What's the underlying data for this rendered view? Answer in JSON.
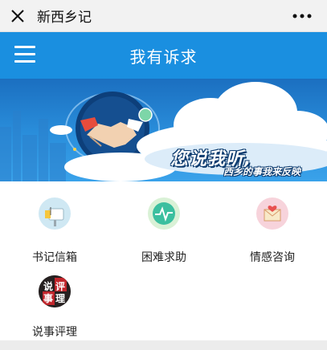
{
  "window": {
    "title": "新西乡记",
    "close_icon": "close-icon",
    "more_icon": "more-dots-icon"
  },
  "header": {
    "title": "我有诉求",
    "menu_icon": "hamburger-menu-icon",
    "color": "#1a8fe0"
  },
  "banner": {
    "slogan": "您说我听,",
    "subslogan": "西乡的事我来反映",
    "image": "handshake-cloud-illustration"
  },
  "services": [
    {
      "label": "书记信箱",
      "icon": "mailbox-icon"
    },
    {
      "label": "困难求助",
      "icon": "heartbeat-icon"
    },
    {
      "label": "情感咨询",
      "icon": "love-letter-icon"
    },
    {
      "label": "说事评理",
      "icon": "discuss-reason-icon",
      "icon_text": "说评事理"
    }
  ]
}
